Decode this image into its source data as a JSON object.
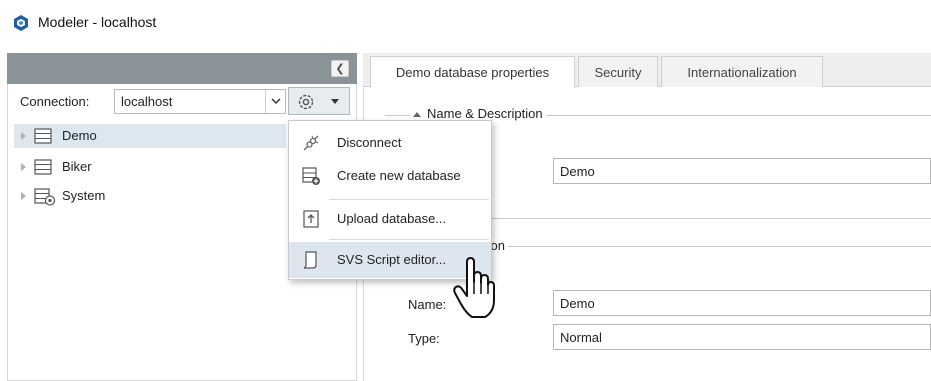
{
  "window": {
    "title": "Modeler - localhost"
  },
  "connection": {
    "label": "Connection:",
    "value": "localhost"
  },
  "tree": {
    "items": [
      {
        "label": "Demo",
        "icon": "database-icon"
      },
      {
        "label": "Biker",
        "icon": "database-icon"
      },
      {
        "label": "System",
        "icon": "system-database-icon"
      }
    ]
  },
  "context_menu": {
    "items": [
      {
        "label": "Disconnect",
        "icon": "disconnect-icon"
      },
      {
        "label": "Create new database",
        "icon": "create-database-icon"
      },
      {
        "label": "Upload database...",
        "icon": "upload-icon"
      },
      {
        "label": "SVS Script editor...",
        "icon": "script-icon"
      }
    ]
  },
  "tabs": [
    {
      "label": "Demo database properties"
    },
    {
      "label": "Security"
    },
    {
      "label": "Internationalization"
    }
  ],
  "groups": {
    "name_description": {
      "title": "Name & Description",
      "field_value": "Demo"
    },
    "second": {
      "title_fragment": "tion",
      "name_label": "Name:",
      "name_value": "Demo",
      "type_label": "Type:",
      "type_value": "Normal"
    }
  },
  "colors": {
    "panel_header": "#8a9498",
    "selection": "#dde7ef",
    "app_icon": "#1f5fa8"
  }
}
